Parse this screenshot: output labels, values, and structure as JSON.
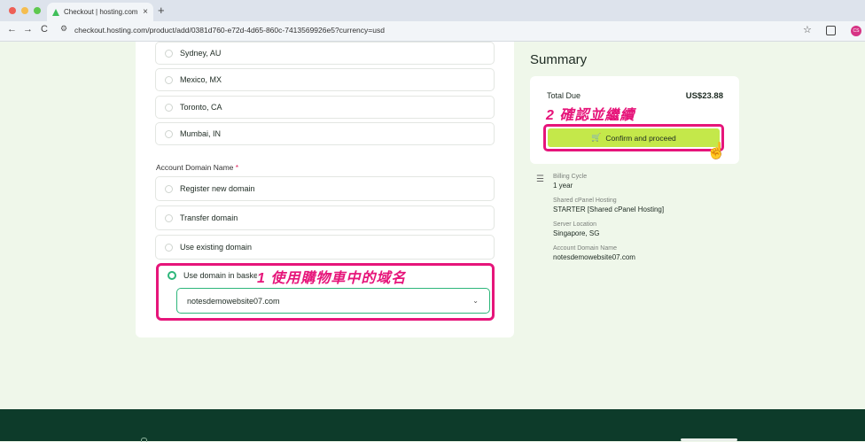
{
  "browser": {
    "tab_title": "Checkout | hosting.com",
    "tab_close": "×",
    "new_tab": "+",
    "url": "checkout.hosting.com/product/add/0381d760-e72d-4d65-860c-7413569926e5?currency=usd",
    "back": "←",
    "forward": "→",
    "reload": "C",
    "star": "☆",
    "avatar": "CS",
    "dot_colors": [
      "#ee5f56",
      "#f5bd4f",
      "#5ec84e"
    ]
  },
  "locations": [
    {
      "label": "Sydney, AU"
    },
    {
      "label": "Mexico, MX"
    },
    {
      "label": "Toronto, CA"
    },
    {
      "label": "Mumbai, IN"
    }
  ],
  "domain": {
    "section_label": "Account Domain Name",
    "required_mark": "*",
    "options": [
      {
        "label": "Register new domain"
      },
      {
        "label": "Transfer domain"
      },
      {
        "label": "Use existing domain"
      }
    ],
    "selected_option": "Use domain in basket",
    "selected_domain": "notesdemowebsite07.com",
    "chevron": "⌄"
  },
  "annotations": {
    "step1": "1 使用購物車中的域名",
    "step2": "2 確認並繼續"
  },
  "summary": {
    "title": "Summary",
    "total_label": "Total Due",
    "total_value": "US$23.88",
    "confirm_label": "Confirm and proceed",
    "details": [
      {
        "key": "Billing Cycle",
        "value": "1 year"
      },
      {
        "key": "Shared cPanel Hosting",
        "value": "STARTER [Shared cPanel Hosting]"
      },
      {
        "key": "Server Location",
        "value": "Singapore, SG"
      },
      {
        "key": "Account Domain Name",
        "value": "notesdemowebsite07.com"
      }
    ]
  },
  "colors": {
    "accent": "#c4e84a",
    "highlight": "#e6157a",
    "selected": "#2db67a",
    "footer": "#0d3b2a",
    "page_bg": "#eff7ea"
  }
}
